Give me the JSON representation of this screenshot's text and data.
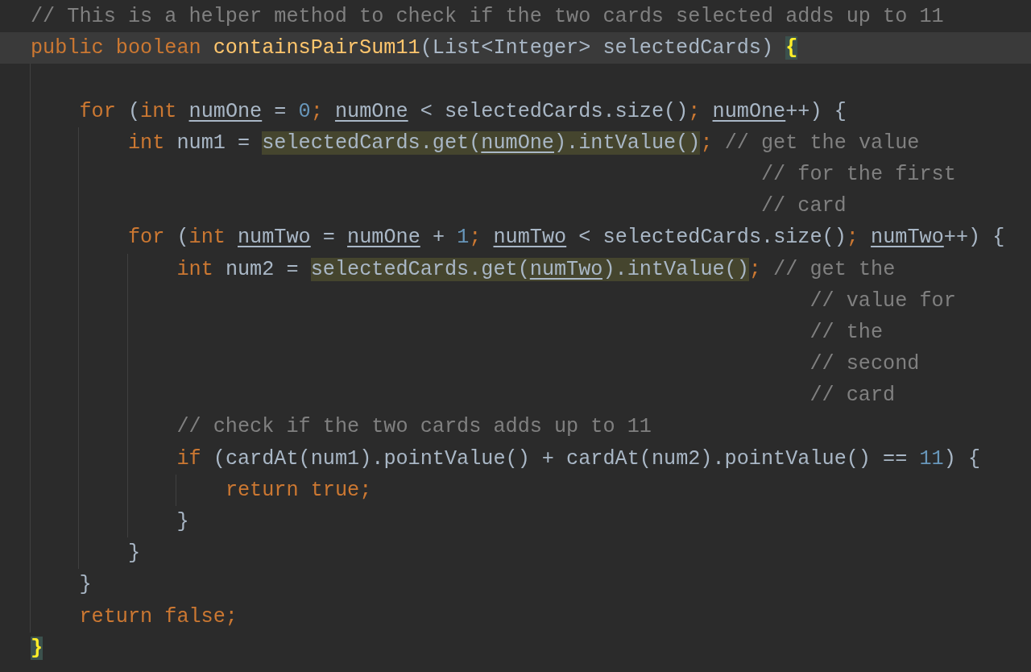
{
  "editor": {
    "lines": [
      {
        "kind": "code",
        "current": false,
        "tokens": [
          {
            "text": "// This is a helper method to check if the two cards selected adds up to 11",
            "kind": "comment",
            "highlighted": false
          }
        ]
      },
      {
        "kind": "code",
        "current": true,
        "tokens": [
          {
            "text": "public boolean ",
            "kind": "keyword",
            "highlighted": false
          },
          {
            "text": "containsPairSum11",
            "kind": "method",
            "highlighted": false
          },
          {
            "text": "(List<Integer> selectedCards) ",
            "kind": "plain",
            "highlighted": false
          },
          {
            "text": "{",
            "kind": "matched-open",
            "highlighted": false
          }
        ]
      },
      {
        "kind": "code",
        "current": false
      },
      {
        "kind": "code",
        "current": false,
        "tokens": [
          {
            "text": "for ",
            "kind": "keyword",
            "highlighted": false
          },
          {
            "text": "(",
            "kind": "plain",
            "highlighted": false
          },
          {
            "text": "int ",
            "kind": "keyword",
            "highlighted": false
          },
          {
            "text": "numOne",
            "kind": "var",
            "highlighted": false
          },
          {
            "text": " = ",
            "kind": "plain",
            "highlighted": false
          },
          {
            "text": "0",
            "kind": "number",
            "highlighted": false
          },
          {
            "text": "; ",
            "kind": "semi",
            "highlighted": false
          },
          {
            "text": "numOne",
            "kind": "var",
            "highlighted": false
          },
          {
            "text": " < selectedCards.size()",
            "kind": "plain",
            "highlighted": false
          },
          {
            "text": "; ",
            "kind": "semi",
            "highlighted": false
          },
          {
            "text": "numOne",
            "kind": "var",
            "highlighted": false
          },
          {
            "text": "++) ",
            "kind": "plain",
            "highlighted": false
          },
          {
            "text": "{",
            "kind": "open",
            "highlighted": false
          }
        ]
      },
      {
        "kind": "code",
        "current": false,
        "tokens": [
          {
            "text": "int ",
            "kind": "keyword",
            "highlighted": false
          },
          {
            "text": "num1 = ",
            "kind": "plain",
            "highlighted": false
          },
          {
            "text": "selectedCards.get(",
            "kind": "plain",
            "highlighted": true
          },
          {
            "text": "numOne",
            "kind": "var",
            "highlighted": true
          },
          {
            "text": ").intValue()",
            "kind": "plain",
            "highlighted": true
          },
          {
            "text": "; ",
            "kind": "semi",
            "highlighted": false
          },
          {
            "text": "// get the value",
            "kind": "comment",
            "highlighted": false
          }
        ]
      },
      {
        "kind": "continuation",
        "current": false,
        "tokens": [
          {
            "text": "// for the first",
            "kind": "comment",
            "highlighted": false
          }
        ]
      },
      {
        "kind": "continuation",
        "current": false,
        "tokens": [
          {
            "text": "// card",
            "kind": "comment",
            "highlighted": false
          }
        ]
      },
      {
        "kind": "code",
        "current": false,
        "tokens": [
          {
            "text": "for ",
            "kind": "keyword",
            "highlighted": false
          },
          {
            "text": "(",
            "kind": "plain",
            "highlighted": false
          },
          {
            "text": "int ",
            "kind": "keyword",
            "highlighted": false
          },
          {
            "text": "numTwo",
            "kind": "var",
            "highlighted": false
          },
          {
            "text": " = ",
            "kind": "plain",
            "highlighted": false
          },
          {
            "text": "numOne",
            "kind": "var",
            "highlighted": false
          },
          {
            "text": " + ",
            "kind": "plain",
            "highlighted": false
          },
          {
            "text": "1",
            "kind": "number",
            "highlighted": false
          },
          {
            "text": "; ",
            "kind": "semi",
            "highlighted": false
          },
          {
            "text": "numTwo",
            "kind": "var",
            "highlighted": false
          },
          {
            "text": " < selectedCards.size()",
            "kind": "plain",
            "highlighted": false
          },
          {
            "text": "; ",
            "kind": "semi",
            "highlighted": false
          },
          {
            "text": "numTwo",
            "kind": "var",
            "highlighted": false
          },
          {
            "text": "++) ",
            "kind": "plain",
            "highlighted": false
          },
          {
            "text": "{",
            "kind": "open",
            "highlighted": false
          }
        ]
      },
      {
        "kind": "code",
        "current": false,
        "tokens": [
          {
            "text": "int ",
            "kind": "keyword",
            "highlighted": false
          },
          {
            "text": "num2 = ",
            "kind": "plain",
            "highlighted": false
          },
          {
            "text": "selectedCards.get(",
            "kind": "plain",
            "highlighted": true
          },
          {
            "text": "numTwo",
            "kind": "var",
            "highlighted": true
          },
          {
            "text": ").intValue()",
            "kind": "plain",
            "highlighted": true
          },
          {
            "text": "; ",
            "kind": "semi",
            "highlighted": false
          },
          {
            "text": "// get the",
            "kind": "comment",
            "highlighted": false
          }
        ]
      },
      {
        "kind": "continuation",
        "current": false,
        "tokens": [
          {
            "text": "// value for",
            "kind": "comment",
            "highlighted": false
          }
        ]
      },
      {
        "kind": "continuation",
        "current": false,
        "tokens": [
          {
            "text": "// the",
            "kind": "comment",
            "highlighted": false
          }
        ]
      },
      {
        "kind": "continuation",
        "current": false,
        "tokens": [
          {
            "text": "// second",
            "kind": "comment",
            "highlighted": false
          }
        ]
      },
      {
        "kind": "continuation",
        "current": false,
        "tokens": [
          {
            "text": "// card",
            "kind": "comment",
            "highlighted": false
          }
        ]
      },
      {
        "kind": "code",
        "current": false,
        "tokens": [
          {
            "text": "// check if the two cards adds up to 11",
            "kind": "comment",
            "highlighted": false
          }
        ]
      },
      {
        "kind": "code",
        "current": false,
        "tokens": [
          {
            "text": "if ",
            "kind": "keyword",
            "highlighted": false
          },
          {
            "text": "(cardAt(num1).pointValue() + cardAt(num2).pointValue() == ",
            "kind": "plain",
            "highlighted": false
          },
          {
            "text": "11",
            "kind": "number",
            "highlighted": false
          },
          {
            "text": ") ",
            "kind": "plain",
            "highlighted": false
          },
          {
            "text": "{",
            "kind": "open",
            "highlighted": false
          }
        ]
      },
      {
        "kind": "code",
        "current": false,
        "tokens": [
          {
            "text": "return true",
            "kind": "keyword",
            "highlighted": false
          },
          {
            "text": ";",
            "kind": "semi",
            "highlighted": false
          }
        ]
      },
      {
        "kind": "code",
        "current": false,
        "tokens": [
          {
            "text": "}",
            "kind": "close",
            "highlighted": false
          }
        ]
      },
      {
        "kind": "code",
        "current": false,
        "tokens": [
          {
            "text": "}",
            "kind": "close",
            "highlighted": false
          }
        ]
      },
      {
        "kind": "code",
        "current": false,
        "tokens": [
          {
            "text": "}",
            "kind": "close",
            "highlighted": false
          }
        ]
      },
      {
        "kind": "code",
        "current": false,
        "tokens": [
          {
            "text": "return false",
            "kind": "keyword",
            "highlighted": false
          },
          {
            "text": ";",
            "kind": "semi",
            "highlighted": false
          }
        ]
      },
      {
        "kind": "code",
        "current": false,
        "tokens": [
          {
            "text": "}",
            "kind": "matched-close",
            "highlighted": false
          }
        ]
      }
    ]
  }
}
